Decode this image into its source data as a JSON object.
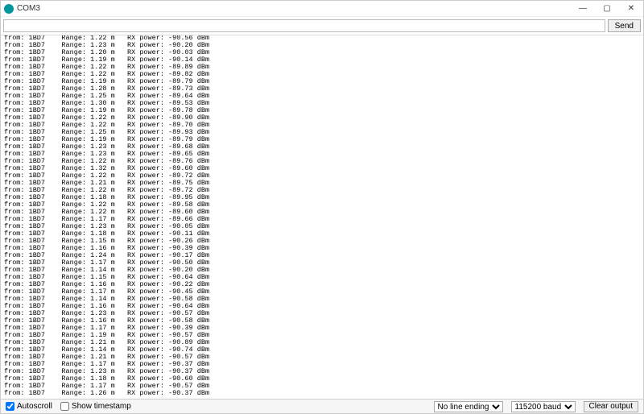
{
  "window": {
    "title": "COM3",
    "buttons": {
      "min": "—",
      "max": "▢",
      "close": "✕"
    }
  },
  "inputrow": {
    "placeholder": "",
    "value": "",
    "send_label": "Send"
  },
  "bottombar": {
    "autoscroll_label": "Autoscroll",
    "autoscroll_checked": true,
    "timestamp_label": "Show timestamp",
    "timestamp_checked": false,
    "line_ending": "No line ending",
    "baud": "115200 baud",
    "clear_label": "Clear output"
  },
  "serial": {
    "from_id": "1BD7",
    "rows": [
      {
        "range": "1.22",
        "rx": "-90.56"
      },
      {
        "range": "1.23",
        "rx": "-90.20"
      },
      {
        "range": "1.20",
        "rx": "-90.03"
      },
      {
        "range": "1.19",
        "rx": "-90.14"
      },
      {
        "range": "1.22",
        "rx": "-89.89"
      },
      {
        "range": "1.22",
        "rx": "-89.82"
      },
      {
        "range": "1.19",
        "rx": "-89.79"
      },
      {
        "range": "1.28",
        "rx": "-89.73"
      },
      {
        "range": "1.25",
        "rx": "-89.64"
      },
      {
        "range": "1.30",
        "rx": "-89.53"
      },
      {
        "range": "1.19",
        "rx": "-89.78"
      },
      {
        "range": "1.22",
        "rx": "-89.90"
      },
      {
        "range": "1.22",
        "rx": "-89.70"
      },
      {
        "range": "1.25",
        "rx": "-89.93"
      },
      {
        "range": "1.19",
        "rx": "-89.79"
      },
      {
        "range": "1.23",
        "rx": "-89.68"
      },
      {
        "range": "1.23",
        "rx": "-89.65"
      },
      {
        "range": "1.22",
        "rx": "-89.76"
      },
      {
        "range": "1.32",
        "rx": "-89.60"
      },
      {
        "range": "1.22",
        "rx": "-89.72"
      },
      {
        "range": "1.21",
        "rx": "-89.75"
      },
      {
        "range": "1.22",
        "rx": "-89.72"
      },
      {
        "range": "1.18",
        "rx": "-89.95"
      },
      {
        "range": "1.22",
        "rx": "-89.58"
      },
      {
        "range": "1.22",
        "rx": "-89.60"
      },
      {
        "range": "1.17",
        "rx": "-89.66"
      },
      {
        "range": "1.23",
        "rx": "-90.05"
      },
      {
        "range": "1.18",
        "rx": "-90.11"
      },
      {
        "range": "1.15",
        "rx": "-90.26"
      },
      {
        "range": "1.16",
        "rx": "-90.39"
      },
      {
        "range": "1.24",
        "rx": "-90.17"
      },
      {
        "range": "1.17",
        "rx": "-90.50"
      },
      {
        "range": "1.14",
        "rx": "-90.20"
      },
      {
        "range": "1.15",
        "rx": "-90.64"
      },
      {
        "range": "1.16",
        "rx": "-90.22"
      },
      {
        "range": "1.17",
        "rx": "-90.45"
      },
      {
        "range": "1.14",
        "rx": "-90.58"
      },
      {
        "range": "1.16",
        "rx": "-90.64"
      },
      {
        "range": "1.23",
        "rx": "-90.57"
      },
      {
        "range": "1.16",
        "rx": "-90.58"
      },
      {
        "range": "1.17",
        "rx": "-90.39"
      },
      {
        "range": "1.19",
        "rx": "-90.57"
      },
      {
        "range": "1.21",
        "rx": "-90.89"
      },
      {
        "range": "1.14",
        "rx": "-90.74"
      },
      {
        "range": "1.21",
        "rx": "-90.57"
      },
      {
        "range": "1.17",
        "rx": "-90.37"
      },
      {
        "range": "1.23",
        "rx": "-90.37"
      },
      {
        "range": "1.18",
        "rx": "-90.60"
      },
      {
        "range": "1.17",
        "rx": "-90.57"
      },
      {
        "range": "1.26",
        "rx": "-90.37"
      }
    ]
  }
}
